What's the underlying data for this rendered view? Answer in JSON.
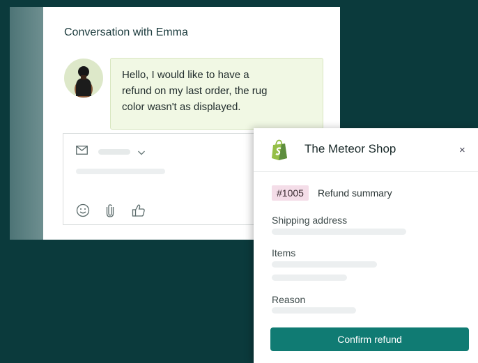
{
  "conversation": {
    "title": "Conversation with Emma",
    "message_lines": [
      "Hello, I would like to have a",
      "refund on my last order, the rug",
      "color wasn't as displayed."
    ]
  },
  "composer": {
    "icons": [
      "mail-icon",
      "chevron-down-icon",
      "emoji-icon",
      "paperclip-icon",
      "thumbs-up-icon"
    ]
  },
  "shop": {
    "name": "The Meteor Shop",
    "close_label": "×",
    "order_number": "#1005",
    "summary_label": "Refund summary",
    "fields": {
      "shipping": "Shipping address",
      "items": "Items",
      "reason": "Reason"
    },
    "confirm_label": "Confirm refund"
  },
  "colors": {
    "background": "#0b3a3c",
    "accent": "#107b73",
    "bubble": "#f1f8e4",
    "badge": "#f4dde8"
  }
}
